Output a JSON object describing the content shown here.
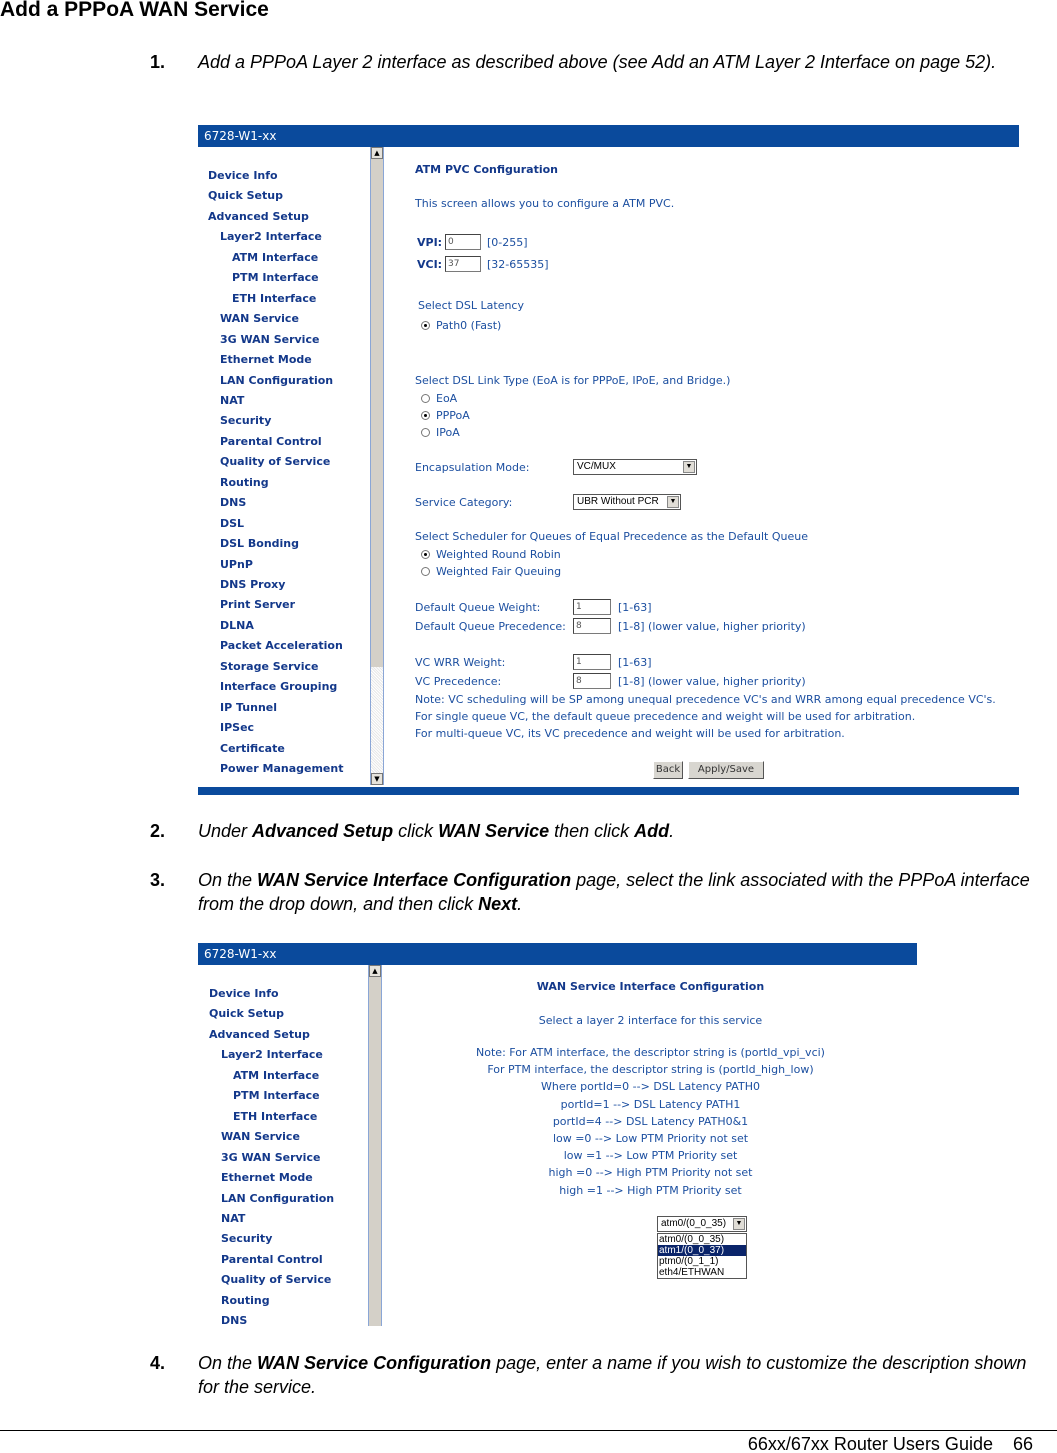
{
  "doc": {
    "title": "Add a PPPoA WAN Service",
    "steps": [
      {
        "num": "1.",
        "parts": [
          "Add a PPPoA Layer 2 interface as described above (see Add an ATM Layer 2 Interface on page 52)."
        ]
      },
      {
        "num": "2.",
        "pre": "Under ",
        "b1": "Advanced Setup",
        "mid1": " click ",
        "b2": "WAN Service",
        "mid2": " then click ",
        "b3": "Add",
        "post": "."
      },
      {
        "num": "3.",
        "pre": "On the ",
        "b1": "WAN Service Interface Configuration",
        "mid1": " page, select the link associated with the PPPoA interface from the drop down, and then click ",
        "b2": "Next",
        "post": "."
      },
      {
        "num": "4.",
        "pre": "On the ",
        "b1": "WAN Service Configuration",
        "post": " page, enter a name if you wish to customize the description shown for the service."
      }
    ],
    "footer": {
      "guide": "66xx/67xx Router Users Guide",
      "page": "66"
    }
  },
  "shot1": {
    "window_title": "6728-W1-xx",
    "menu": [
      "Device Info",
      "Quick Setup",
      "Advanced Setup",
      "Layer2 Interface",
      "ATM Interface",
      "PTM Interface",
      "ETH Interface",
      "WAN Service",
      "3G WAN Service",
      "Ethernet Mode",
      "LAN Configuration",
      "NAT",
      "Security",
      "Parental Control",
      "Quality of Service",
      "Routing",
      "DNS",
      "DSL",
      "DSL Bonding",
      "UPnP",
      "DNS Proxy",
      "Print Server",
      "DLNA",
      "Packet Acceleration",
      "Storage Service",
      "Interface Grouping",
      "IP Tunnel",
      "IPSec",
      "Certificate",
      "Power Management"
    ],
    "heading": "ATM PVC Configuration",
    "intro": "This screen allows you to configure a ATM PVC.",
    "vpi": {
      "label": "VPI:",
      "value": "0",
      "range": "[0-255]"
    },
    "vci": {
      "label": "VCI:",
      "value": "37",
      "range": "[32-65535]"
    },
    "latency": {
      "label": "Select DSL Latency",
      "option": "Path0 (Fast)"
    },
    "link_type": {
      "label": "Select DSL Link Type (EoA is for PPPoE, IPoE, and Bridge.)",
      "options": [
        "EoA",
        "PPPoA",
        "IPoA"
      ],
      "selected": "PPPoA"
    },
    "encap": {
      "label": "Encapsulation Mode:",
      "value": "VC/MUX"
    },
    "service": {
      "label": "Service Category:",
      "value": "UBR Without PCR"
    },
    "scheduler": {
      "label": "Select Scheduler for Queues of Equal Precedence as the Default Queue",
      "options": [
        "Weighted Round Robin",
        "Weighted Fair Queuing"
      ],
      "selected": "Weighted Round Robin"
    },
    "dq_weight": {
      "label": "Default Queue Weight:",
      "value": "1",
      "range": "[1-63]"
    },
    "dq_prec": {
      "label": "Default Queue Precedence:",
      "value": "8",
      "range": "[1-8] (lower value, higher priority)"
    },
    "vc_weight": {
      "label": "VC WRR Weight:",
      "value": "1",
      "range": "[1-63]"
    },
    "vc_prec": {
      "label": "VC Precedence:",
      "value": "8",
      "range": "[1-8] (lower value, higher priority)"
    },
    "notes": [
      "Note: VC scheduling will be SP among unequal precedence VC's and WRR among equal precedence VC's.",
      "For single queue VC, the default queue precedence and weight will be used for arbitration.",
      "For multi-queue VC, its VC precedence and weight will be used for arbitration."
    ],
    "back": "Back",
    "apply": "Apply/Save"
  },
  "shot2": {
    "window_title": "6728-W1-xx",
    "menu": [
      "Device Info",
      "Quick Setup",
      "Advanced Setup",
      "Layer2 Interface",
      "ATM Interface",
      "PTM Interface",
      "ETH Interface",
      "WAN Service",
      "3G WAN Service",
      "Ethernet Mode",
      "LAN Configuration",
      "NAT",
      "Security",
      "Parental Control",
      "Quality of Service",
      "Routing",
      "DNS"
    ],
    "heading": "WAN Service Interface Configuration",
    "subtitle": "Select a layer 2 interface for this service",
    "notes": [
      "Note: For ATM interface, the descriptor string is (portId_vpi_vci)",
      "For PTM interface, the descriptor string is (portId_high_low)",
      "Where portId=0 --> DSL Latency PATH0",
      "portId=1 --> DSL Latency PATH1",
      "portId=4 --> DSL Latency PATH0&1",
      "low =0 --> Low PTM Priority not set",
      "low =1 --> Low PTM Priority set",
      "high =0 --> High PTM Priority not set",
      "high =1 --> High PTM Priority set"
    ],
    "dropdown": {
      "value": "atm0/(0_0_35)",
      "options": [
        "atm0/(0_0_35)",
        "atm1/(0_0_37)",
        "ptm0/(0_1_1)",
        "eth4/ETHWAN"
      ],
      "highlighted": "atm1/(0_0_37)"
    }
  }
}
